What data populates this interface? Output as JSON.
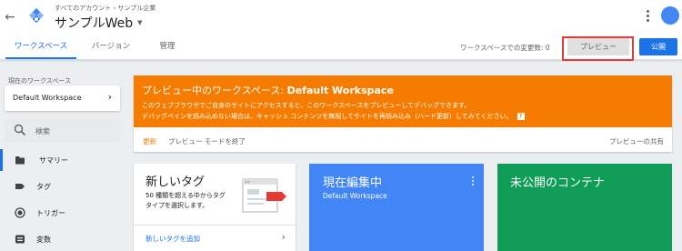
{
  "header": {
    "breadcrumb": "すべてのアカウント › サンプル企業",
    "container_name": "サンプルWeb",
    "back_icon": "arrow-left-icon",
    "logo_icon": "tag-manager-logo-icon",
    "menu_icon": "more-vert-icon",
    "avatar_color": "#4285f4"
  },
  "tabs": [
    {
      "label": "ワークスペース",
      "active": true
    },
    {
      "label": "バージョン",
      "active": false
    },
    {
      "label": "管理",
      "active": false
    }
  ],
  "toolbar": {
    "changes_label": "ワークスペースでの変更数: 0",
    "preview_label": "プレビュー",
    "publish_label": "公開",
    "highlight_color": "#e53935"
  },
  "sidebar": {
    "workspace_label": "現在のワークスペース",
    "workspace_value": "Default Workspace",
    "search_placeholder": "検索",
    "items": [
      {
        "label": "サマリー",
        "icon": "folder-icon",
        "active": true
      },
      {
        "label": "タグ",
        "icon": "tag-icon",
        "active": false
      },
      {
        "label": "トリガー",
        "icon": "trigger-icon",
        "active": false
      },
      {
        "label": "変数",
        "icon": "variables-icon",
        "active": false
      }
    ]
  },
  "preview_banner": {
    "title_prefix": "プレビュー中のワークスペース: ",
    "title_workspace": "Default Workspace",
    "line1": "このウェブブラウザでご自身のサイトにアクセスすると、このワークスペースをプレビューしてデバッグできます。",
    "line2": "デバッグペインを読み込めない場合は、キャッシュ コンテンツを無視してサイトを再読み込み（ハード更新）してみてください。",
    "help_icon": "help-icon",
    "help_glyph": "?",
    "update_label": "更新",
    "exit_label": "プレビュー モードを終了",
    "share_label": "プレビューの共有",
    "color": "#f57c00"
  },
  "cards": {
    "new_tag": {
      "title": "新しいタグ",
      "description": "50 種類を超える中からタグタイプを選択します。",
      "link_label": "新しいタグを追加"
    },
    "editing": {
      "title": "現在編集中",
      "subtitle": "Default Workspace",
      "color": "#4285f4"
    },
    "unpublished": {
      "title": "未公開のコンテナ",
      "color": "#0f9d58"
    }
  }
}
